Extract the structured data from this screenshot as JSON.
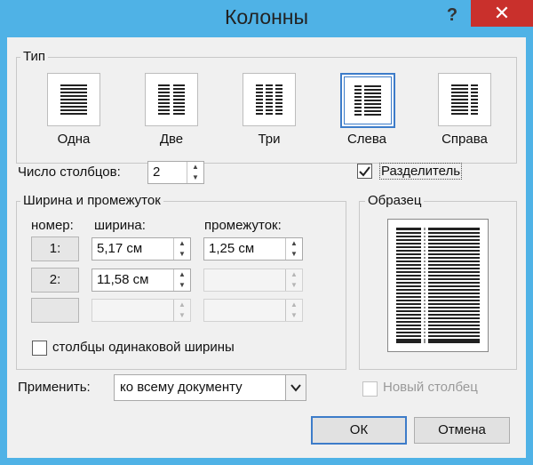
{
  "window": {
    "title": "Колонны",
    "help_glyph": "?",
    "close_glyph": "✕"
  },
  "type_group": {
    "legend": "Тип",
    "presets": [
      {
        "id": "one",
        "label": "Одна",
        "selected": false
      },
      {
        "id": "two",
        "label": "Две",
        "selected": false
      },
      {
        "id": "three",
        "label": "Три",
        "selected": false
      },
      {
        "id": "left",
        "label": "Слева",
        "selected": true
      },
      {
        "id": "right",
        "label": "Справа",
        "selected": false
      }
    ]
  },
  "num_columns": {
    "label": "Число столбцов:",
    "value": "2"
  },
  "separator": {
    "label": "Разделитель",
    "checked": true
  },
  "width_spacing": {
    "legend": "Ширина и промежуток",
    "headers": {
      "number": "номер:",
      "width": "ширина:",
      "spacing": "промежуток:"
    },
    "rows": [
      {
        "number": "1:",
        "width": "5,17 см",
        "spacing": "1,25 см"
      },
      {
        "number": "2:",
        "width": "11,58 см",
        "spacing": ""
      },
      {
        "number": "",
        "width": "",
        "spacing": ""
      }
    ],
    "equal_width": {
      "label": "столбцы одинаковой ширины",
      "checked": false
    }
  },
  "sample": {
    "legend": "Образец"
  },
  "apply": {
    "label": "Применить:",
    "value": "ко всему документу"
  },
  "new_column": {
    "label": "Новый столбец",
    "checked": false,
    "enabled": false
  },
  "buttons": {
    "ok": "ОК",
    "cancel": "Отмена"
  },
  "colors": {
    "accent": "#3d7cc9",
    "titlebar": "#4fb2e6",
    "close": "#c9302c",
    "dialog": "#f0f0f0"
  }
}
